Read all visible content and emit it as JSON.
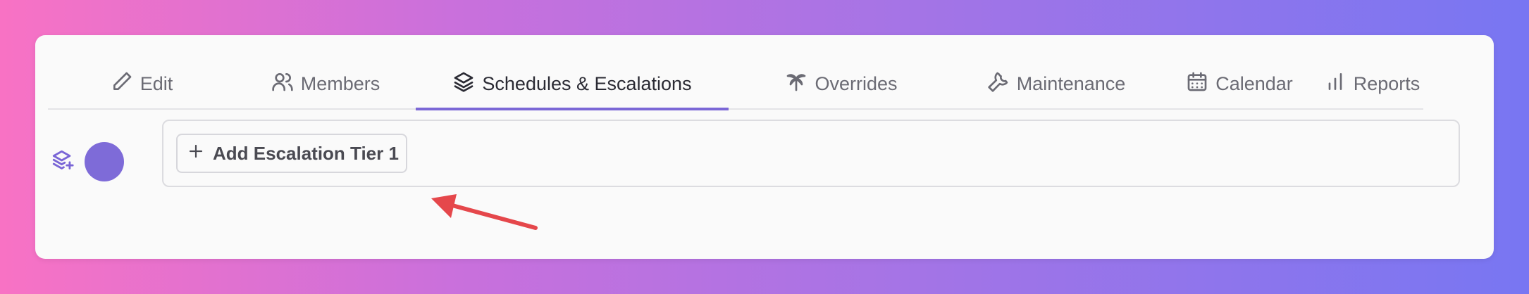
{
  "tabs": [
    {
      "label": "Edit",
      "icon": "pencil-icon"
    },
    {
      "label": "Members",
      "icon": "users-icon"
    },
    {
      "label": "Schedules & Escalations",
      "icon": "layers-icon",
      "active": true
    },
    {
      "label": "Overrides",
      "icon": "palm-tree-icon"
    },
    {
      "label": "Maintenance",
      "icon": "wrench-icon"
    },
    {
      "label": "Calendar",
      "icon": "calendar-icon"
    },
    {
      "label": "Reports",
      "icon": "bar-chart-icon"
    }
  ],
  "escalation": {
    "add_tier_label": "Add Escalation Tier 1"
  },
  "colors": {
    "accent": "#7b67d6",
    "annotation_arrow": "#e5474b"
  }
}
